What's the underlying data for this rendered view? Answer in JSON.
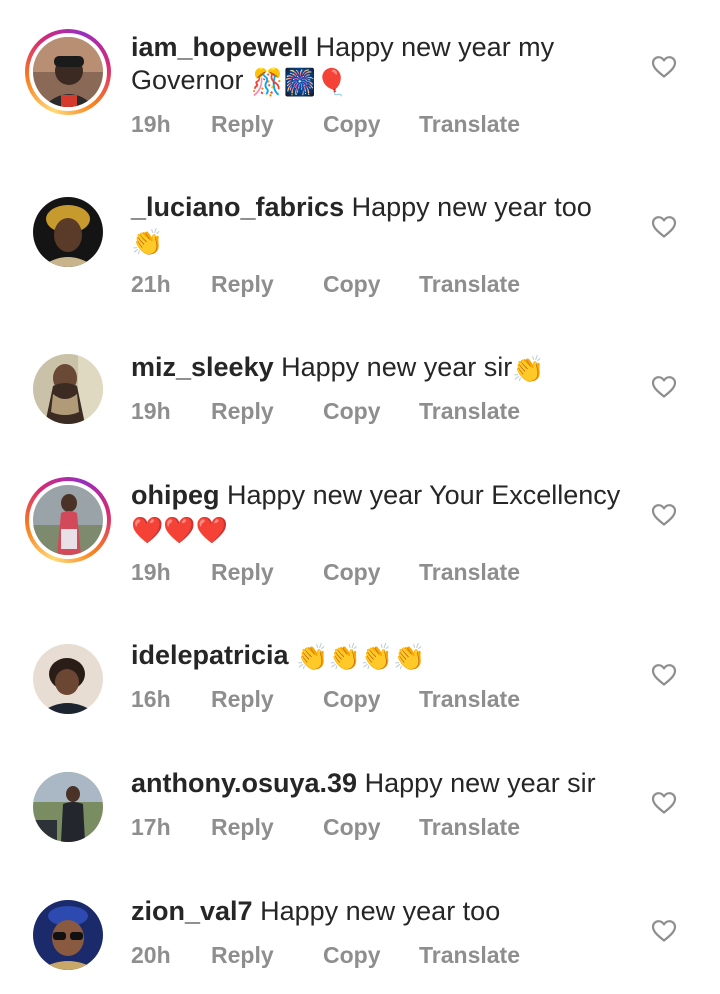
{
  "comments": [
    {
      "username": "iam_hopewell",
      "text": "Happy new year my Governor",
      "emojis": "🎊🎆🎈",
      "time": "19h",
      "story_ring": true
    },
    {
      "username": "_luciano_fabrics",
      "text": "Happy new year too",
      "emojis": "👏",
      "time": "21h",
      "story_ring": false
    },
    {
      "username": "miz_sleeky",
      "text": "Happy new year sir",
      "emojis": "👏",
      "time": "19h",
      "story_ring": false
    },
    {
      "username": "ohipeg",
      "text": "Happy new year Your Excellency",
      "emojis": "❤️❤️❤️",
      "time": "19h",
      "story_ring": true
    },
    {
      "username": "idelepatricia",
      "text": "",
      "emojis": "👏👏👏👏",
      "time": "16h",
      "story_ring": false
    },
    {
      "username": "anthony.osuya.39",
      "text": "Happy new year sir",
      "emojis": "",
      "time": "17h",
      "story_ring": false
    },
    {
      "username": "zion_val7",
      "text": "Happy new year too",
      "emojis": "",
      "time": "20h",
      "story_ring": false
    }
  ],
  "actions": {
    "reply": "Reply",
    "copy": "Copy",
    "translate": "Translate"
  },
  "icons": {
    "like": "heart-outline-icon"
  },
  "colors": {
    "text": "#262626",
    "secondary": "#8e8e8e",
    "heart_stroke": "#8e8e8e"
  }
}
